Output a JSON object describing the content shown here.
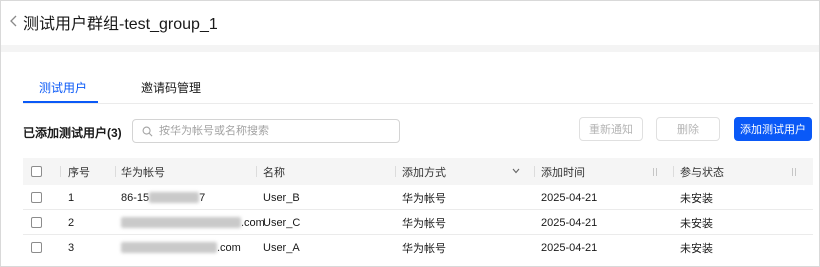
{
  "header": {
    "title": "测试用户群组-test_group_1"
  },
  "tabs": [
    {
      "label": "测试用户",
      "active": true
    },
    {
      "label": "邀请码管理",
      "active": false
    }
  ],
  "toolbar": {
    "count_label": "已添加测试用户(3)",
    "search_placeholder": "按华为帐号或名称搜索",
    "renotify_label": "重新通知",
    "delete_label": "删除",
    "add_label": "添加测试用户"
  },
  "table": {
    "columns": {
      "index": "序号",
      "account": "华为帐号",
      "name": "名称",
      "method": "添加方式",
      "time": "添加时间",
      "status": "参与状态"
    },
    "rows": [
      {
        "index": "1",
        "account_prefix": "86-15",
        "account_suffix": "7",
        "name": "User_B",
        "method": "华为帐号",
        "time": "2025-04-21",
        "status": "未安装"
      },
      {
        "index": "2",
        "account_prefix": "",
        "account_suffix": ".com",
        "name": "User_C",
        "method": "华为帐号",
        "time": "2025-04-21",
        "status": "未安装"
      },
      {
        "index": "3",
        "account_prefix": "",
        "account_suffix": ".com",
        "name": "User_A",
        "method": "华为帐号",
        "time": "2025-04-21",
        "status": "未安装"
      }
    ]
  },
  "colors": {
    "accent": "#0a59f7",
    "header_band": "#f4f4f4",
    "table_header": "#f5f5f5"
  }
}
